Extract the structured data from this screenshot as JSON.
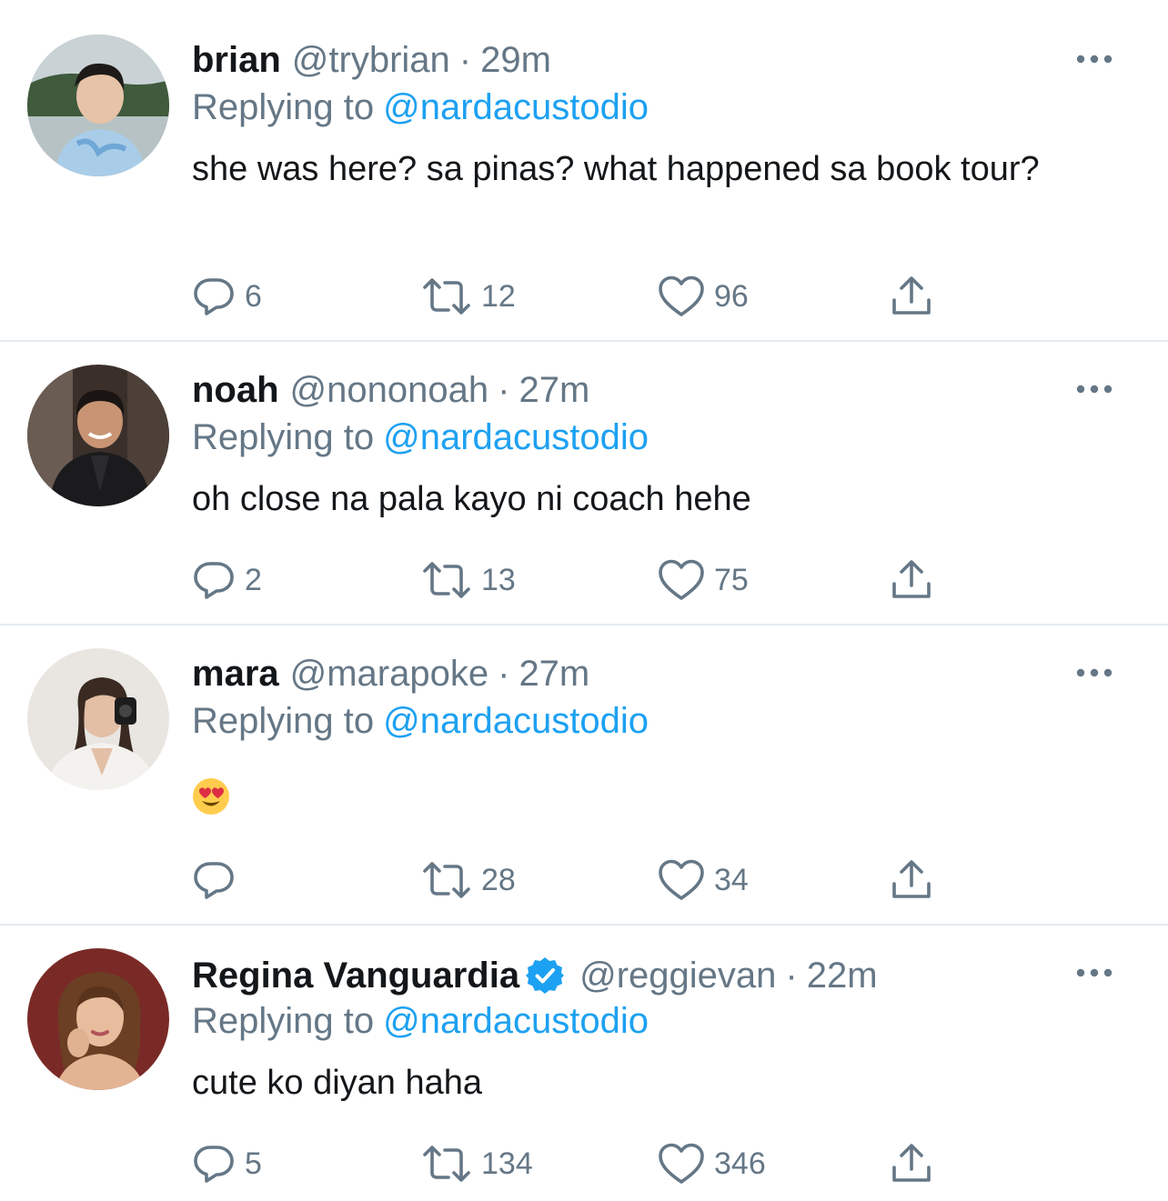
{
  "tweets": [
    {
      "name": "brian",
      "handle": "@trybrian",
      "dot": "·",
      "time": "29m",
      "replying_prefix": "Replying to",
      "mention": "@nardacustodio",
      "text": "she was here? sa pinas? what happened sa book tour?",
      "replies": "6",
      "retweets": "12",
      "likes": "96",
      "verified": false
    },
    {
      "name": "noah",
      "handle": "@nononoah",
      "dot": "·",
      "time": "27m",
      "replying_prefix": "Replying to",
      "mention": "@nardacustodio",
      "text": "oh close na pala kayo ni coach hehe",
      "replies": "2",
      "retweets": "13",
      "likes": "75",
      "verified": false
    },
    {
      "name": "mara",
      "handle": "@marapoke",
      "dot": "·",
      "time": "27m",
      "replying_prefix": "Replying to",
      "mention": "@nardacustodio",
      "text": "",
      "emoji": "heart-eyes-emoji",
      "replies": "",
      "retweets": "28",
      "likes": "34",
      "verified": false
    },
    {
      "name": "Regina Vanguardia",
      "handle": "@reggievan",
      "dot": "·",
      "time": "22m",
      "replying_prefix": "Replying to",
      "mention": "@nardacustodio",
      "text": "cute ko diyan haha",
      "replies": "5",
      "retweets": "134",
      "likes": "346",
      "verified": true
    }
  ],
  "colors": {
    "link": "#1da1f2",
    "secondary_text": "#657786",
    "primary_text": "#14171a",
    "divider": "#e6ecf0"
  },
  "icons": [
    "reply-icon",
    "retweet-icon",
    "like-icon",
    "share-icon",
    "more-icon",
    "verified-badge-icon"
  ]
}
